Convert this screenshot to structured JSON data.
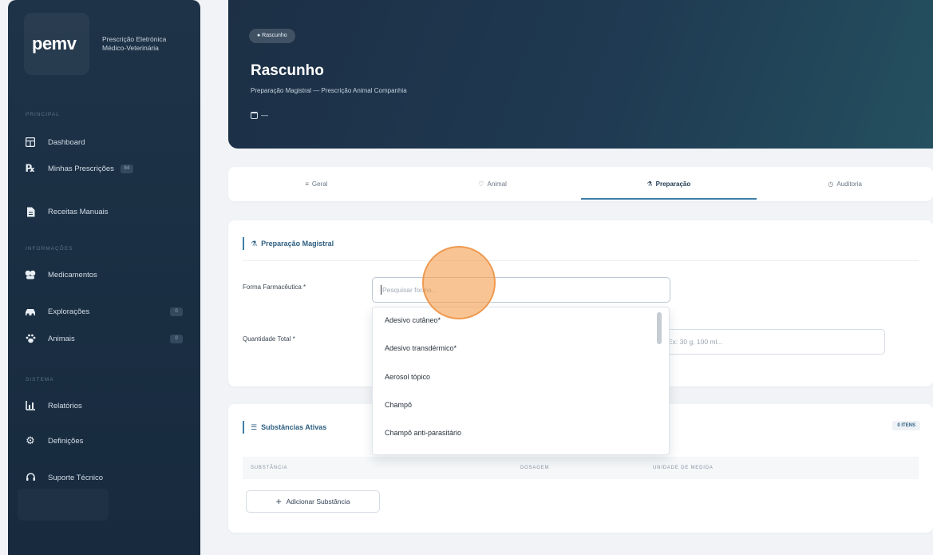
{
  "brand": {
    "logo": "pemv",
    "subtitle_line1": "Prescrição Eletrónica",
    "subtitle_line2": "Médico-Veterinária"
  },
  "sidebar": {
    "sections": [
      "Principal",
      "Informações",
      "Sistema"
    ],
    "items": [
      {
        "label": "Dashboard",
        "icon": "grid-icon"
      },
      {
        "label": "Minhas Prescrições",
        "icon": "rx-icon",
        "badge": "84"
      },
      {
        "label": "Receitas Manuais",
        "icon": "document-icon"
      },
      {
        "label": "Medicamentos",
        "icon": "pills-icon"
      },
      {
        "label": "Explorações",
        "icon": "farm-icon",
        "badge": "0"
      },
      {
        "label": "Animais",
        "icon": "paw-icon",
        "badge": "0"
      },
      {
        "label": "Relatórios",
        "icon": "chart-icon"
      },
      {
        "label": "Definições",
        "icon": "gear-icon"
      },
      {
        "label": "Suporte Técnico",
        "icon": "support-icon"
      }
    ]
  },
  "header": {
    "status": "● Rascunho",
    "title": "Rascunho",
    "subtitle": "Preparação Magistral — Prescrição Animal Companhia",
    "date": "—"
  },
  "tabs": [
    {
      "label": "Geral",
      "icon": "≡"
    },
    {
      "label": "Animal",
      "icon": "♡"
    },
    {
      "label": "Preparação",
      "icon": "⚗"
    },
    {
      "label": "Auditoria",
      "icon": "◷"
    }
  ],
  "preparation": {
    "title": "Preparação Magistral",
    "form_label": "Forma Farmacêutica *",
    "form_placeholder": "Pesquisar forma...",
    "qty_label": "Quantidade Total *",
    "qty_placeholder": "Ex: 30 g, 100 ml...",
    "options": [
      "Adesivo cutâneo*",
      "Adesivo transdérmico*",
      "Aerosol tópico",
      "Champô",
      "Champô anti-parasitário"
    ]
  },
  "substances": {
    "title": "Substâncias Ativas",
    "items_badge": "0 ITENS",
    "columns": [
      "Substância",
      "Dosagem",
      "Unidade de Medida"
    ],
    "add_label": "Adicionar Substância"
  },
  "colors": {
    "sidebar": "#1e3348",
    "accent": "#3d7fa6",
    "touch": "#f5a050"
  }
}
